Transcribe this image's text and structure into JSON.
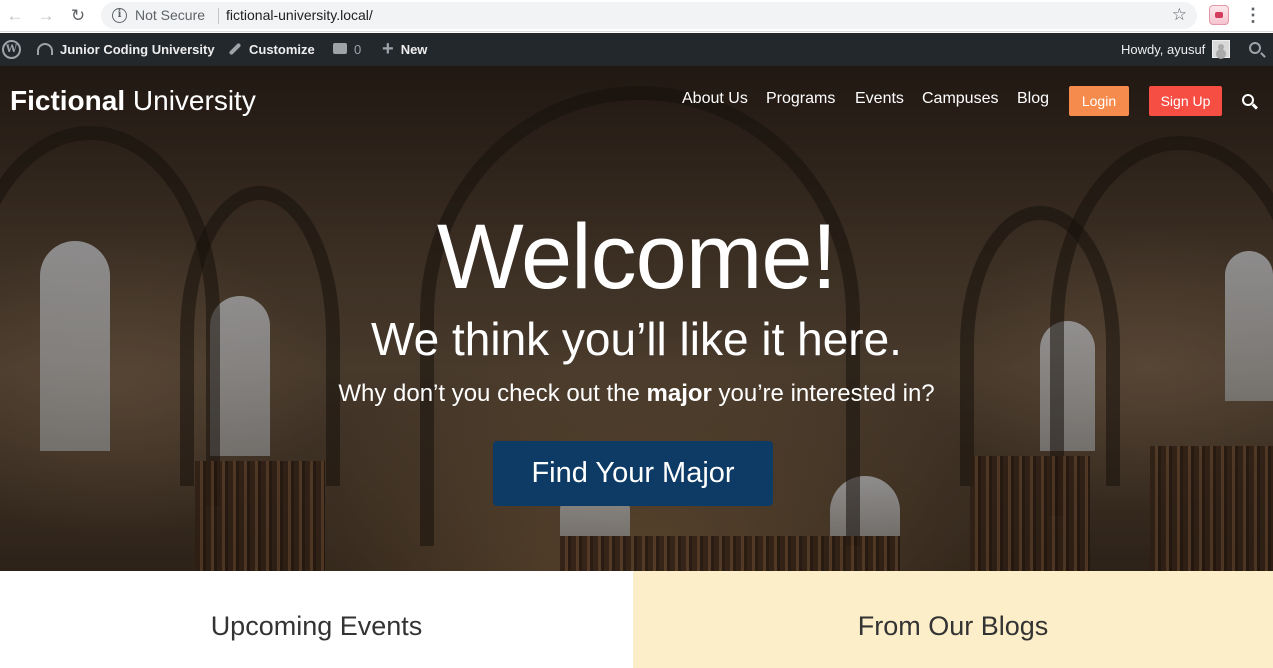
{
  "browser": {
    "security_label": "Not Secure",
    "url": "fictional-university.local/"
  },
  "admin_bar": {
    "site_name": "Junior Coding University",
    "customize": "Customize",
    "comments_count": "0",
    "new_label": "New",
    "greeting": "Howdy, ayusuf"
  },
  "header": {
    "logo_bold": "Fictional",
    "logo_light": "University",
    "nav": [
      "About Us",
      "Programs",
      "Events",
      "Campuses",
      "Blog"
    ],
    "login": "Login",
    "signup": "Sign Up"
  },
  "hero": {
    "heading": "Welcome!",
    "subheading": "We think you’ll like it here.",
    "question_pre": "Why don’t you check out the ",
    "question_bold": "major",
    "question_post": " you’re interested in?",
    "cta": "Find Your Major"
  },
  "sections": {
    "events_title": "Upcoming Events",
    "blogs_title": "From Our Blogs"
  },
  "colors": {
    "login": "#f68b4e",
    "signup": "#f74e44",
    "cta": "#0d3b66",
    "admin_bar": "#23282d",
    "blogs_bg": "#fbeec8"
  }
}
